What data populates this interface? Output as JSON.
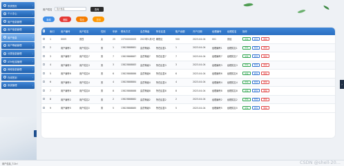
{
  "sidebar": {
    "items": [
      {
        "label": "系统首页",
        "active": false
      },
      {
        "label": "个人中心",
        "active": false
      },
      {
        "label": "用户信息管理",
        "active": false
      },
      {
        "label": "用户信息管理",
        "active": false
      },
      {
        "label": "用户信息",
        "active": true
      },
      {
        "label": "用户等级管理",
        "active": false
      },
      {
        "label": "分类信息管理",
        "active": false
      },
      {
        "label": "ATM信息管理",
        "active": false
      },
      {
        "label": "网络信息管理",
        "active": false
      },
      {
        "label": "在线签到",
        "active": false
      },
      {
        "label": "系统管理",
        "active": false
      }
    ],
    "subitem_label": "用户信息"
  },
  "search": {
    "label": "用户姓名",
    "placeholder": "用户姓名",
    "button": "查询"
  },
  "actions": {
    "add": "新增",
    "delete": "删除",
    "export": "导出",
    "print": "打印",
    "colors": {
      "add": "#3e8ee8",
      "delete": "#e53935",
      "export": "#f57c00",
      "print": "#ff9800"
    }
  },
  "table": {
    "headers": [
      "索引",
      "用户编号",
      "用户姓名",
      "性别",
      "年龄",
      "联系方式",
      "会员等级",
      "所在区县",
      "账户余额",
      "开户日期",
      "经理编号",
      "经理姓名",
      "操作"
    ],
    "rows": [
      [
        "1",
        "0005",
        "张四",
        "女",
        "25",
        "13700000005",
        "2023年1月5日",
        "朝阳区",
        "500",
        "2023-04-04",
        "001",
        "张经"
      ],
      [
        "2",
        "用户编号1",
        "用户姓名1",
        "男",
        "1",
        "13823888881",
        "会员等级1",
        "所在区县1",
        "1",
        "2023-04-04",
        "经理编号1",
        "经理姓名1"
      ],
      [
        "3",
        "用户编号7",
        "用户姓名7",
        "男",
        "7",
        "13823888887",
        "会员等级7",
        "所在区县7",
        "7",
        "2023-04-04",
        "经理编号7",
        "经理姓名7"
      ],
      [
        "4",
        "用户编号3",
        "用户姓名3",
        "男",
        "3",
        "13823888883",
        "会员等级3",
        "所在区县3",
        "3",
        "2023-04-04",
        "经理编号3",
        "经理姓名3"
      ],
      [
        "5",
        "用户编号6",
        "用户姓名6",
        "男",
        "6",
        "13823888886",
        "会员等级6",
        "所在区县6",
        "6",
        "2023-04-04",
        "经理编号6",
        "经理姓名6"
      ],
      [
        "6",
        "用户编号4",
        "用户姓名4",
        "男",
        "4",
        "13823888884",
        "会员等级4",
        "所在区县4",
        "4",
        "2023-04-04",
        "经理编号4",
        "经理姓名4"
      ],
      [
        "7",
        "用户编号8",
        "用户姓名8",
        "男",
        "8",
        "13823888888",
        "会员等级8",
        "所在区县8",
        "8",
        "2023-04-04",
        "经理编号8",
        "经理姓名8"
      ],
      [
        "8",
        "用户编号2",
        "用户姓名2",
        "男",
        "2",
        "13823888882",
        "会员等级2",
        "所在区县2",
        "2",
        "2023-04-04",
        "经理编号2",
        "经理姓名2"
      ],
      [
        "9",
        "用户编号5",
        "用户姓名5",
        "男",
        "5",
        "13823888885",
        "会员等级5",
        "所在区县5",
        "5",
        "2023-04-04",
        "经理编号5",
        "经理姓名5"
      ]
    ],
    "ops": {
      "detail": "详情",
      "edit": "修改",
      "delete": "删除"
    }
  },
  "footer": {
    "version": "用户信息_T.Ctrl",
    "watermark": "CSDN @shell-20..."
  }
}
